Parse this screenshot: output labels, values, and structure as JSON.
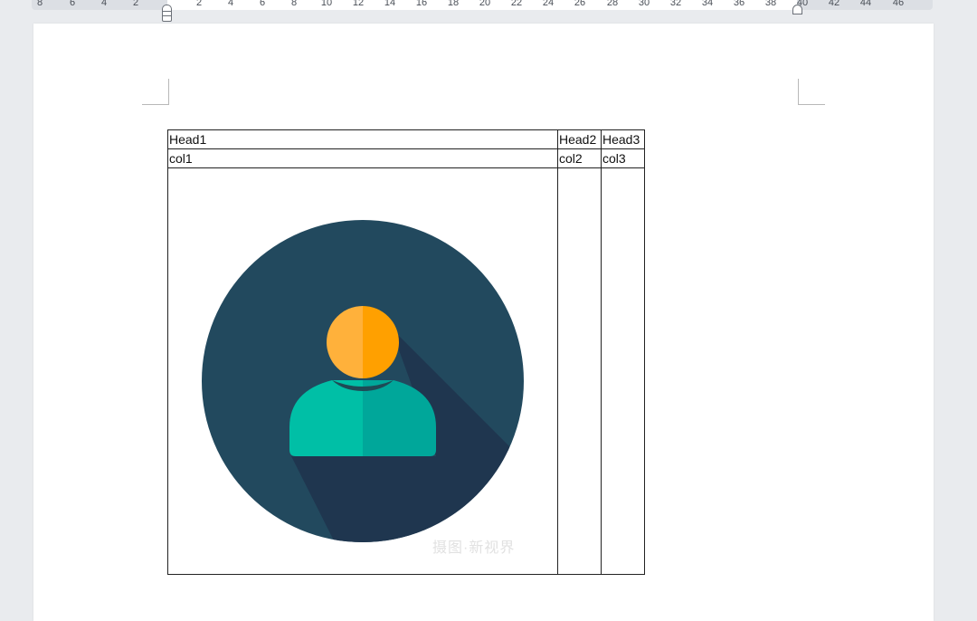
{
  "ruler": {
    "ticks": [
      "8",
      "6",
      "4",
      "2",
      "2",
      "4",
      "6",
      "8",
      "10",
      "12",
      "14",
      "16",
      "18",
      "20",
      "22",
      "24",
      "26",
      "28",
      "30",
      "32",
      "34",
      "36",
      "38",
      "40",
      "42",
      "44",
      "46"
    ]
  },
  "table": {
    "header": [
      "Head1",
      "Head2",
      "Head3"
    ],
    "row": [
      "col1",
      "col2",
      "col3"
    ]
  },
  "image": {
    "icon": "user-avatar-icon",
    "watermark": "摄图·新视界"
  },
  "colors": {
    "circle": "#22495e",
    "shadow": "#1f364f",
    "head_left": "#ffb13b",
    "head_right": "#ffa000",
    "body_left": "#00bfa6",
    "body_right": "#00a79a"
  }
}
